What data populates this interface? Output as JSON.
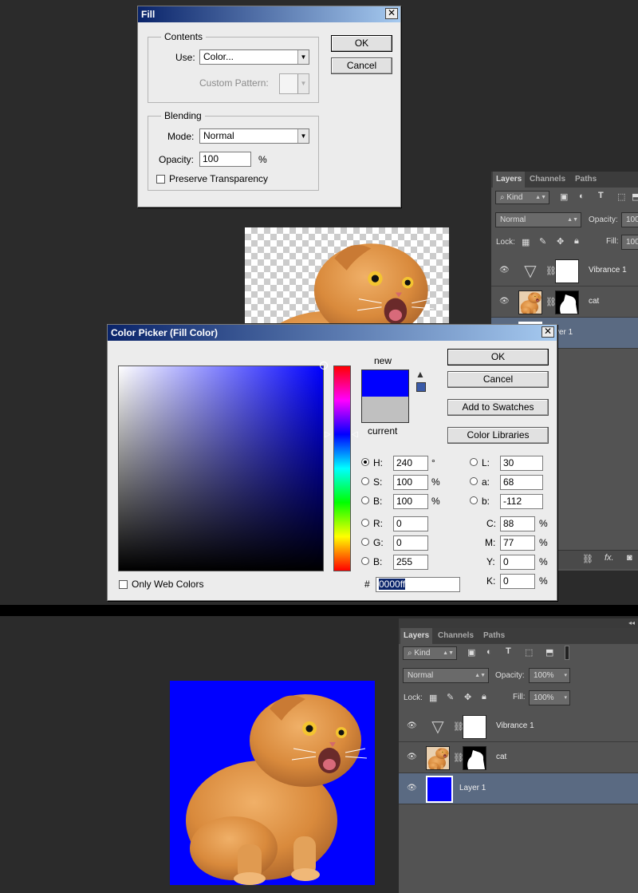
{
  "fill_dialog": {
    "title": "Fill",
    "contents_legend": "Contents",
    "use_label": "Use:",
    "use_value": "Color...",
    "custom_pattern_label": "Custom Pattern:",
    "blending_legend": "Blending",
    "mode_label": "Mode:",
    "mode_value": "Normal",
    "opacity_label": "Opacity:",
    "opacity_value": "100",
    "opacity_unit": "%",
    "preserve_label": "Preserve Transparency",
    "ok_label": "OK",
    "cancel_label": "Cancel"
  },
  "color_picker": {
    "title": "Color Picker (Fill Color)",
    "new_label": "new",
    "current_label": "current",
    "new_color": "#0000ff",
    "current_color": "#c0c0c0",
    "ok_label": "OK",
    "cancel_label": "Cancel",
    "swatches_label": "Add to Swatches",
    "libraries_label": "Color Libraries",
    "only_web_label": "Only Web Colors",
    "h_label": "H:",
    "h_value": "240",
    "h_unit": "°",
    "s_label": "S:",
    "s_value": "100",
    "s_unit": "%",
    "b_label": "B:",
    "b_value": "100",
    "b_unit": "%",
    "r_label": "R:",
    "r_value": "0",
    "g_label": "G:",
    "g_value": "0",
    "bl_label": "B:",
    "bl_value": "255",
    "l_label": "L:",
    "l_value": "30",
    "a_label": "a:",
    "a_value": "68",
    "lab_b_label": "b:",
    "lab_b_value": "-112",
    "c_label": "C:",
    "c_value": "88",
    "c_unit": "%",
    "m_label": "M:",
    "m_value": "77",
    "m_unit": "%",
    "y_label": "Y:",
    "y_value": "0",
    "y_unit": "%",
    "k_label": "K:",
    "k_value": "0",
    "k_unit": "%",
    "hash_label": "#",
    "hex_value": "0000ff"
  },
  "layers_panel_top": {
    "tabs": [
      "Layers",
      "Channels",
      "Paths"
    ],
    "kind_label": "Kind",
    "blend_mode": "Normal",
    "opacity_label": "Opacity:",
    "opacity_value": "100",
    "lock_label": "Lock:",
    "fill_label": "Fill:",
    "fill_value": "100",
    "layers": [
      "Vibrance 1",
      "cat",
      "yer 1"
    ]
  },
  "layers_panel_bottom": {
    "tabs": [
      "Layers",
      "Channels",
      "Paths"
    ],
    "kind_label": "Kind",
    "blend_mode": "Normal",
    "opacity_label": "Opacity:",
    "opacity_value": "100%",
    "lock_label": "Lock:",
    "fill_label": "Fill:",
    "fill_value": "100%",
    "layers": [
      "Vibrance 1",
      "cat",
      "Layer 1"
    ]
  },
  "colors": {
    "fill_blue": "#0000ff",
    "cat_orange": "#d98a3c",
    "selected_row": "#5a6a82"
  }
}
